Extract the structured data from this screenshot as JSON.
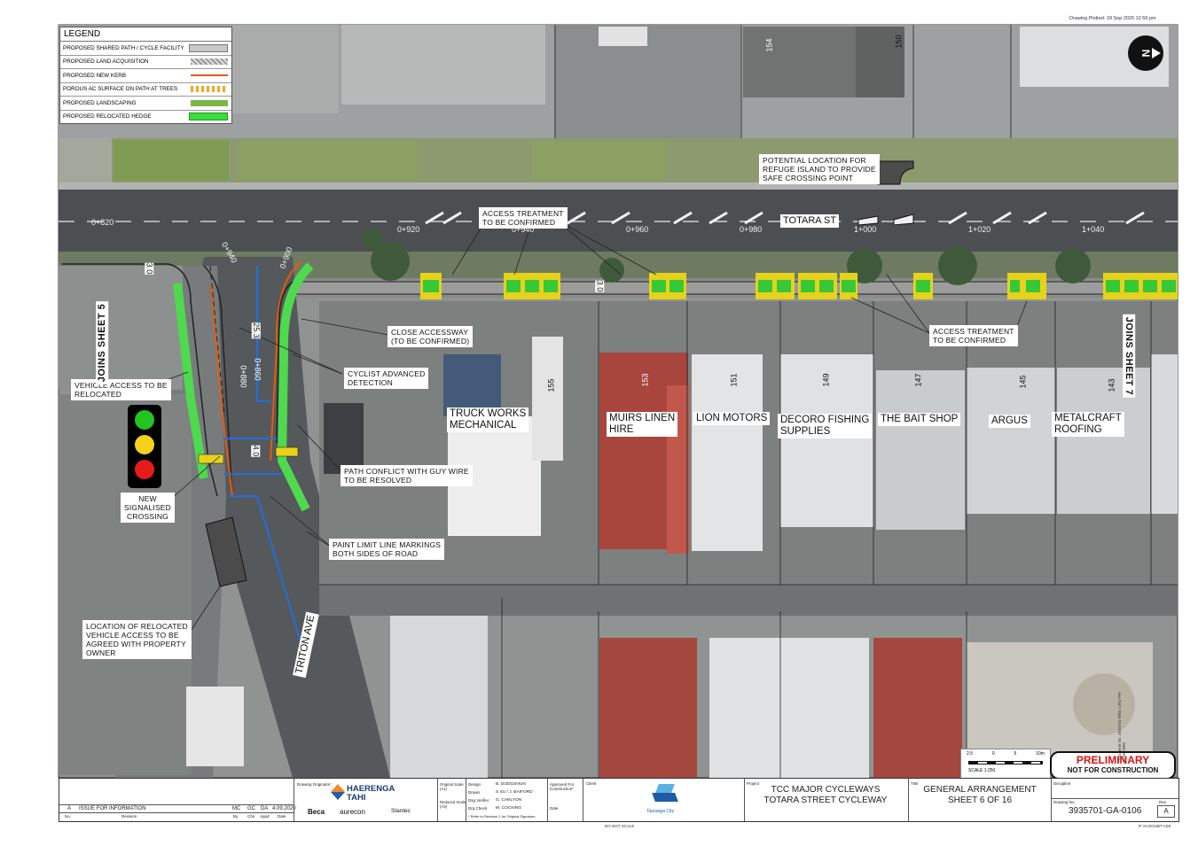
{
  "drawing_plotted": "Drawing Plotted:   18 Sep 2020   12:59 pm",
  "north_symbol": "N",
  "legend": {
    "title": "LEGEND",
    "items": [
      {
        "label": "PROPOSED SHARED PATH / CYCLE FACILITY",
        "color": "#c8c8c8"
      },
      {
        "label": "PROPOSED LAND ACQUISITION",
        "color": "#b0b0b0"
      },
      {
        "label": "PROPOSED NEW KERB",
        "color": "#e8590c"
      },
      {
        "label": "POROUS AC SURFACE ON PATH AT TREES",
        "color": "#f5a623"
      },
      {
        "label": "PROPOSED LANDSCAPING",
        "color": "#7ab648"
      },
      {
        "label": "PROPOSED RELOCATED HEDGE",
        "color": "#3ddc3d"
      }
    ]
  },
  "annotations": {
    "refuge_island": "POTENTIAL LOCATION FOR\nREFUGE ISLAND TO PROVIDE\nSAFE CROSSING POINT",
    "access_treatment_1": "ACCESS TREATMENT\nTO BE CONFIRMED",
    "access_treatment_2": "ACCESS TREATMENT\nTO BE CONFIRMED",
    "close_accessway": "CLOSE ACCESSWAY\n(TO BE CONFIRMED)",
    "cyclist_detection": "CYCLIST ADVANCED\nDETECTION",
    "vehicle_access": "VEHICLE ACCESS TO BE\nRELOCATED",
    "new_crossing": "NEW\nSIGNALISED\nCROSSING",
    "guy_wire": "PATH CONFLICT WITH GUY WIRE\nTO BE RESOLVED",
    "paint_limit": "PAINT LIMIT LINE MARKINGS\nBOTH SIDES OF ROAD",
    "relocated_access": "LOCATION OF RELOCATED\nVEHICLE ACCESS TO BE\nAGREED WITH PROPERTY\nOWNER"
  },
  "streets": {
    "totara": "TOTARA ST",
    "triton": "TRITON AVE"
  },
  "joins": {
    "left": "JOINS SHEET 5",
    "right": "JOINS SHEET 7"
  },
  "chainages": [
    "0+820",
    "0+920",
    "0+940",
    "0+960",
    "0+980",
    "1+000",
    "1+020",
    "1+040",
    "0+940",
    "0+900",
    "0+880",
    "0+860"
  ],
  "dimensions": {
    "d1": "3.0",
    "d2": "3.0",
    "d3": "4.0",
    "d4": "25.3"
  },
  "businesses": [
    {
      "name": "TRUCK WORKS\nMECHANICAL",
      "number": "155"
    },
    {
      "name": "MUIRS LINEN\nHIRE",
      "number": "153"
    },
    {
      "name": "LION MOTORS",
      "number": "151"
    },
    {
      "name": "DECORO FISHING\nSUPPLIES",
      "number": "149"
    },
    {
      "name": "THE BAIT SHOP",
      "number": "147"
    },
    {
      "name": "ARGUS",
      "number": "145"
    },
    {
      "name": "METALCRAFT\nROOFING",
      "number": "143"
    }
  ],
  "top_numbers": [
    "154",
    "150"
  ],
  "scale": {
    "label": "SCALE 1:250",
    "ticks": [
      "2.5",
      "0",
      "5",
      "10m"
    ]
  },
  "stamp": {
    "main": "PRELIMINARY",
    "sub": "NOT FOR CONSTRUCTION"
  },
  "title_block": {
    "revision_row": {
      "rev": "A",
      "desc": "ISSUE FOR INFORMATION",
      "by1": "MC",
      "by2": "GC",
      "by3": "DA",
      "date": "4.09.2020"
    },
    "rev_headers": [
      "No.",
      "Revision",
      "By",
      "Chk",
      "Appd",
      "Date"
    ],
    "drawing_origination": "Drawing Originator:",
    "logo_main": "HAERENGA",
    "logo_sub": "TAHI",
    "partners": [
      "Beca",
      "aurecon",
      "Stantec"
    ],
    "scale_labels": [
      "Original Scale (A1)",
      "Reduced Scale (A3)"
    ],
    "roles": [
      {
        "role": "Design",
        "name": "B. DODGSHUN"
      },
      {
        "role": "Drawn",
        "name": "S SU / J. BAIFORD"
      },
      {
        "role": "Dsg Verifier",
        "name": "G. CARLYON"
      },
      {
        "role": "Drg Check",
        "name": "M. COCKING"
      }
    ],
    "signature_note": "* Refer to Revision 1 for Original Signature",
    "approved": "Approved For Construction*",
    "date_label": "Date",
    "client_label": "Client",
    "client": "Tauranga City",
    "project_label": "Project",
    "project": "TCC MAJOR CYCLEWAYS\nTOTARA STREET CYCLEWAY",
    "title_label": "Title",
    "title": "GENERAL ARRANGEMENT\nSHEET 6 OF 16",
    "discipline_label": "Discipline",
    "drawing_no_label": "Drawing No.",
    "drawing_no": "3935701-GA-0106",
    "rev_label": "Rev.",
    "rev": "A"
  },
  "footer_left": "DO NOT SCALE",
  "footer_right": "IF IN DOUBT ASK",
  "document_no": "Document No. 3935701-0001-CRG-PR-0106.DWG"
}
